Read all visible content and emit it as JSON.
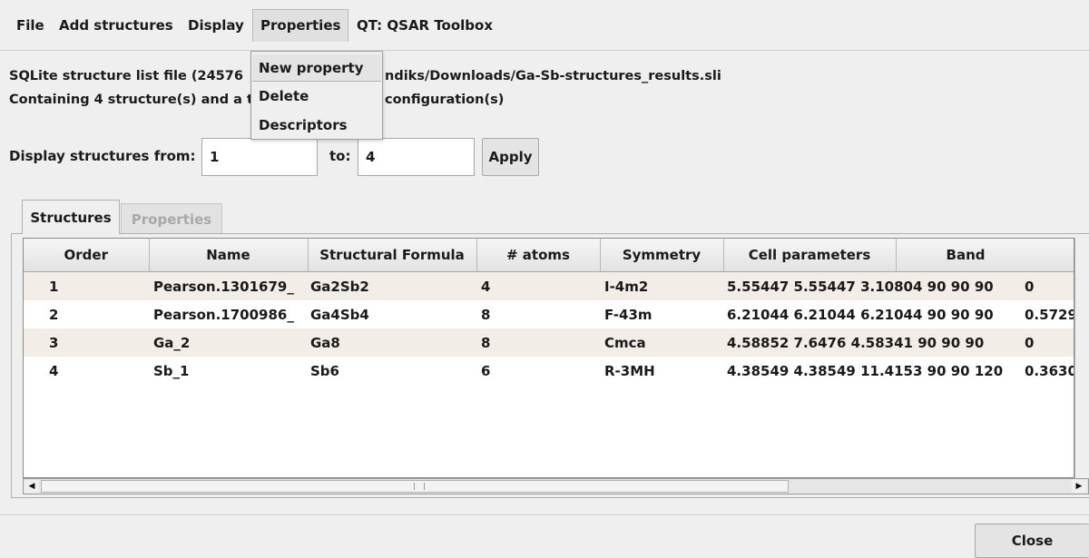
{
  "menubar": {
    "file": "File",
    "add_structures": "Add structures",
    "display": "Display",
    "properties": "Properties",
    "qt": "QT: QSAR Toolbox"
  },
  "dropdown": {
    "new_property": "New property",
    "delete": "Delete",
    "descriptors": "Descriptors"
  },
  "info": {
    "line1_part1": "SQLite structure list file (24576",
    "line1_part2": "ndiks/Downloads/Ga-Sb-structures_results.sli",
    "line2_part1": "Containing 4 structure(s) and a t",
    "line2_part2": "configuration(s)"
  },
  "range": {
    "from_label": "Display structures from:",
    "from_value": "1",
    "to_label": "to:",
    "to_value": "4",
    "apply_label": "Apply"
  },
  "tabs": {
    "structures": "Structures",
    "properties": "Properties"
  },
  "table": {
    "headers": [
      "Order",
      "Name",
      "Structural Formula",
      "# atoms",
      "Symmetry",
      "Cell parameters",
      "Band"
    ],
    "rows": [
      [
        "1",
        "Pearson.1301679_",
        "Ga2Sb2",
        "4",
        "I-4m2",
        "5.55447 5.55447 3.10804 90 90 90",
        "0"
      ],
      [
        "2",
        "Pearson.1700986_",
        "Ga4Sb4",
        "8",
        "F-43m",
        "6.21044 6.21044 6.21044 90 90 90",
        "0.5729"
      ],
      [
        "3",
        "Ga_2",
        "Ga8",
        "8",
        "Cmca",
        "4.58852 7.6476 4.58341 90 90 90",
        "0"
      ],
      [
        "4",
        "Sb_1",
        "Sb6",
        "6",
        "R-3MH",
        "4.38549 4.38549 11.4153 90 90 120",
        "0.3630"
      ]
    ]
  },
  "footer": {
    "close_label": "Close"
  }
}
